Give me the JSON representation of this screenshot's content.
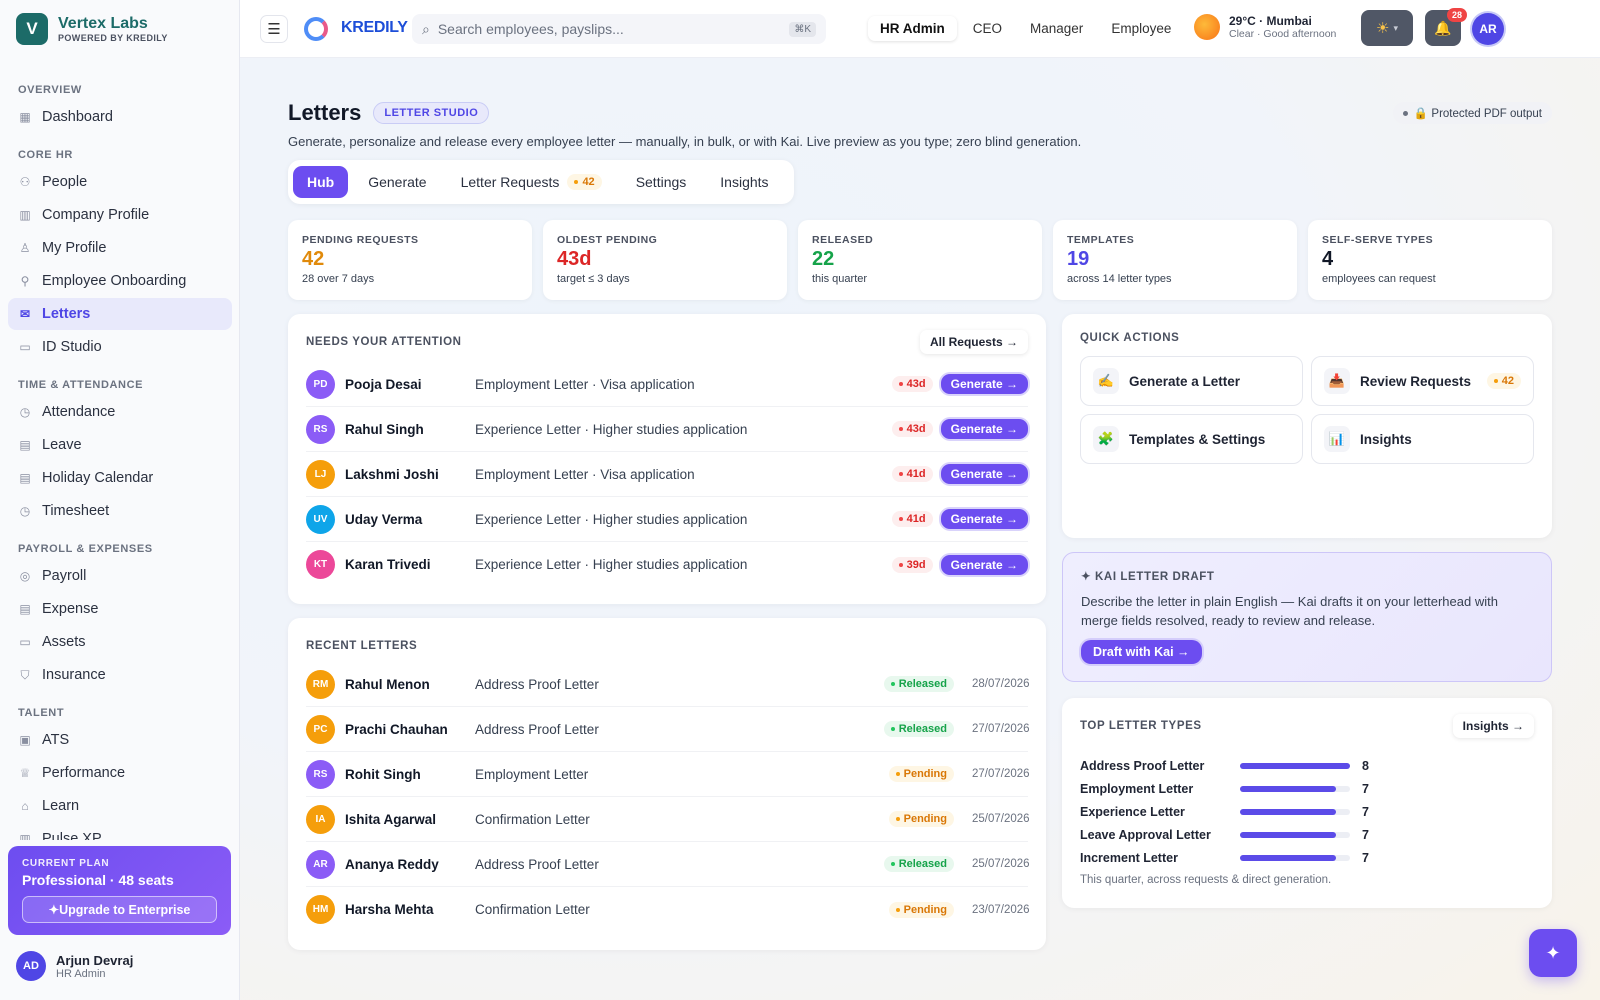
{
  "sidebar": {
    "brand_initial": "V",
    "brand_name": "Vertex Labs",
    "brand_sub": "POWERED BY KREDILY",
    "sections": [
      {
        "title": "OVERVIEW",
        "items": [
          {
            "label": "Dashboard",
            "icon": "grid-icon"
          }
        ]
      },
      {
        "title": "CORE HR",
        "items": [
          {
            "label": "People",
            "icon": "people-icon"
          },
          {
            "label": "Company Profile",
            "icon": "building-icon"
          },
          {
            "label": "My Profile",
            "icon": "user-icon"
          },
          {
            "label": "Employee Onboarding",
            "icon": "user-plus-icon"
          },
          {
            "label": "Letters",
            "icon": "mail-icon",
            "active": true
          },
          {
            "label": "ID Studio",
            "icon": "id-card-icon"
          }
        ]
      },
      {
        "title": "TIME & ATTENDANCE",
        "items": [
          {
            "label": "Attendance",
            "icon": "clock-icon"
          },
          {
            "label": "Leave",
            "icon": "calendar-icon"
          },
          {
            "label": "Holiday Calendar",
            "icon": "calendar-icon"
          },
          {
            "label": "Timesheet",
            "icon": "clock-icon"
          }
        ]
      },
      {
        "title": "PAYROLL & EXPENSES",
        "items": [
          {
            "label": "Payroll",
            "icon": "coin-icon"
          },
          {
            "label": "Expense",
            "icon": "receipt-icon"
          },
          {
            "label": "Assets",
            "icon": "monitor-icon"
          },
          {
            "label": "Insurance",
            "icon": "shield-icon"
          }
        ]
      },
      {
        "title": "TALENT",
        "items": [
          {
            "label": "ATS",
            "icon": "briefcase-icon"
          },
          {
            "label": "Performance",
            "icon": "trophy-icon"
          },
          {
            "label": "Learn",
            "icon": "graduation-cap-icon"
          },
          {
            "label": "Pulse XP",
            "icon": "chart-icon"
          }
        ]
      }
    ],
    "plan": {
      "label": "CURRENT PLAN",
      "name": "Professional · 48 seats",
      "upgrade_label": "✦Upgrade to Enterprise"
    },
    "user": {
      "initials": "AD",
      "name": "Arjun Devraj",
      "role": "HR Admin"
    }
  },
  "topbar": {
    "menu_icon": "hamburger-icon",
    "product_name": "KREDILY",
    "search_placeholder": "Search employees, payslips...",
    "search_shortcut": "⌘K",
    "roles": [
      {
        "label": "HR Admin",
        "active": true
      },
      {
        "label": "CEO"
      },
      {
        "label": "Manager"
      },
      {
        "label": "Employee"
      }
    ],
    "weather_main": "29°C · Mumbai",
    "weather_sub": "Clear · Good afternoon",
    "theme_icon": "sun-icon",
    "notifications_count": "28",
    "avatar_initials": "AR"
  },
  "page": {
    "title": "Letters",
    "badge": "LETTER STUDIO",
    "subtitle": "Generate, personalize and release every employee letter — manually, in bulk, or with Kai. Live preview as you type; zero blind generation.",
    "pdf_badge": "🔒 Protected PDF output",
    "tabs": [
      {
        "label": "Hub",
        "active": true
      },
      {
        "label": "Generate"
      },
      {
        "label": "Letter Requests",
        "count": "42"
      },
      {
        "label": "Settings"
      },
      {
        "label": "Insights"
      }
    ]
  },
  "stats": [
    {
      "label": "PENDING REQUESTS",
      "value": "42",
      "note": "28 over 7 days",
      "color": "#e08a0b"
    },
    {
      "label": "OLDEST PENDING",
      "value": "43d",
      "note": "target ≤ 3 days",
      "color": "#dc2626"
    },
    {
      "label": "RELEASED",
      "value": "22",
      "note": "this quarter",
      "color": "#16a34a"
    },
    {
      "label": "TEMPLATES",
      "value": "19",
      "note": "across 14 letter types",
      "color": "#4f46e5"
    },
    {
      "label": "SELF-SERVE TYPES",
      "value": "4",
      "note": "employees can request",
      "color": "#111827"
    }
  ],
  "attention": {
    "title": "NEEDS YOUR ATTENTION",
    "link_label": "All Requests →",
    "action_label": "Generate →",
    "rows": [
      {
        "initials": "PD",
        "name": "Pooja Desai",
        "desc": "Employment Letter · Visa application",
        "age": "43d",
        "color": "#8b5cf6"
      },
      {
        "initials": "RS",
        "name": "Rahul Singh",
        "desc": "Experience Letter · Higher studies application",
        "age": "43d",
        "color": "#8b5cf6"
      },
      {
        "initials": "LJ",
        "name": "Lakshmi Joshi",
        "desc": "Employment Letter · Visa application",
        "age": "41d",
        "color": "#f59e0b"
      },
      {
        "initials": "UV",
        "name": "Uday Verma",
        "desc": "Experience Letter · Higher studies application",
        "age": "41d",
        "color": "#0ea5e9"
      },
      {
        "initials": "KT",
        "name": "Karan Trivedi",
        "desc": "Experience Letter · Higher studies application",
        "age": "39d",
        "color": "#ec4899"
      }
    ]
  },
  "recent": {
    "title": "RECENT LETTERS",
    "rows": [
      {
        "initials": "RM",
        "name": "Rahul Menon",
        "desc": "Address Proof Letter",
        "status": "Released",
        "date": "28/07/2026",
        "color": "#f59e0b"
      },
      {
        "initials": "PC",
        "name": "Prachi Chauhan",
        "desc": "Address Proof Letter",
        "status": "Released",
        "date": "27/07/2026",
        "color": "#f59e0b"
      },
      {
        "initials": "RS",
        "name": "Rohit Singh",
        "desc": "Employment Letter",
        "status": "Pending",
        "date": "27/07/2026",
        "color": "#8b5cf6"
      },
      {
        "initials": "IA",
        "name": "Ishita Agarwal",
        "desc": "Confirmation Letter",
        "status": "Pending",
        "date": "25/07/2026",
        "color": "#f59e0b"
      },
      {
        "initials": "AR",
        "name": "Ananya Reddy",
        "desc": "Address Proof Letter",
        "status": "Released",
        "date": "25/07/2026",
        "color": "#8b5cf6"
      },
      {
        "initials": "HM",
        "name": "Harsha Mehta",
        "desc": "Confirmation Letter",
        "status": "Pending",
        "date": "23/07/2026",
        "color": "#f59e0b"
      }
    ]
  },
  "quick_actions": {
    "title": "QUICK ACTIONS",
    "items": [
      {
        "label": "Generate a Letter",
        "icon": "✍️",
        "icon_name": "writing-hand-icon"
      },
      {
        "label": "Review Requests",
        "icon": "📥",
        "icon_name": "inbox-tray-icon",
        "count": "42"
      },
      {
        "label": "Templates & Settings",
        "icon": "🧩",
        "icon_name": "puzzle-icon"
      },
      {
        "label": "Insights",
        "icon": "📊",
        "icon_name": "bar-chart-icon"
      }
    ]
  },
  "kai": {
    "title": "✦ KAI LETTER DRAFT",
    "text": "Describe the letter in plain English — Kai drafts it on your letterhead with merge fields resolved, ready to review and release.",
    "button": "Draft with Kai →"
  },
  "top_types": {
    "title": "TOP LETTER TYPES",
    "link_label": "Insights →",
    "max": 8,
    "items": [
      {
        "label": "Address Proof Letter",
        "value": 8
      },
      {
        "label": "Employment Letter",
        "value": 7
      },
      {
        "label": "Experience Letter",
        "value": 7
      },
      {
        "label": "Leave Approval Letter",
        "value": 7
      },
      {
        "label": "Increment Letter",
        "value": 7
      }
    ],
    "note": "This quarter, across requests & direct generation."
  },
  "fab_icon": "sparkle-icon"
}
